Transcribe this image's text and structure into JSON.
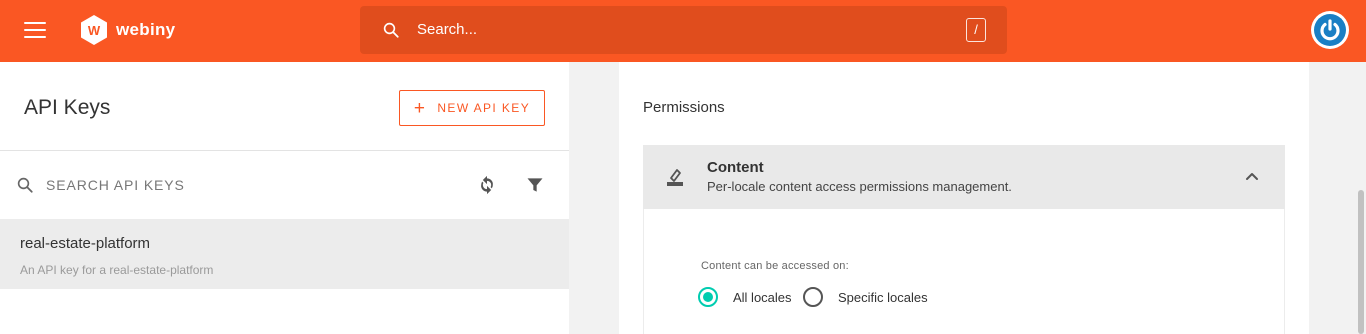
{
  "topbar": {
    "brand": "webiny",
    "search_placeholder": "Search...",
    "search_shortcut": "/",
    "bg_color": "#fa5723"
  },
  "icons": {
    "menu": "hamburger-menu-icon",
    "logo": "webiny-logo-icon",
    "search": "search-icon",
    "avatar": "power-icon",
    "refresh": "refresh-icon",
    "filter": "filter-icon",
    "content": "content-pen-icon",
    "collapse": "chevron-up-icon"
  },
  "left_panel": {
    "title": "API Keys",
    "new_button_icon": "+",
    "new_button_label": "NEW API KEY",
    "search_placeholder": "SEARCH API KEYS",
    "items": [
      {
        "name": "real-estate-platform",
        "description": "An API key for a real-estate-platform"
      }
    ]
  },
  "right_panel": {
    "permissions_title": "Permissions",
    "accordion": {
      "title": "Content",
      "description": "Per-locale content access permissions management.",
      "expanded": true,
      "access_label": "Content can be accessed on:",
      "options": [
        {
          "label": "All locales",
          "selected": true
        },
        {
          "label": "Specific locales",
          "selected": false
        }
      ]
    }
  },
  "colors": {
    "accent": "#fa5723",
    "radio_selected": "#00ccb0",
    "avatar": "#1a7fc4"
  }
}
